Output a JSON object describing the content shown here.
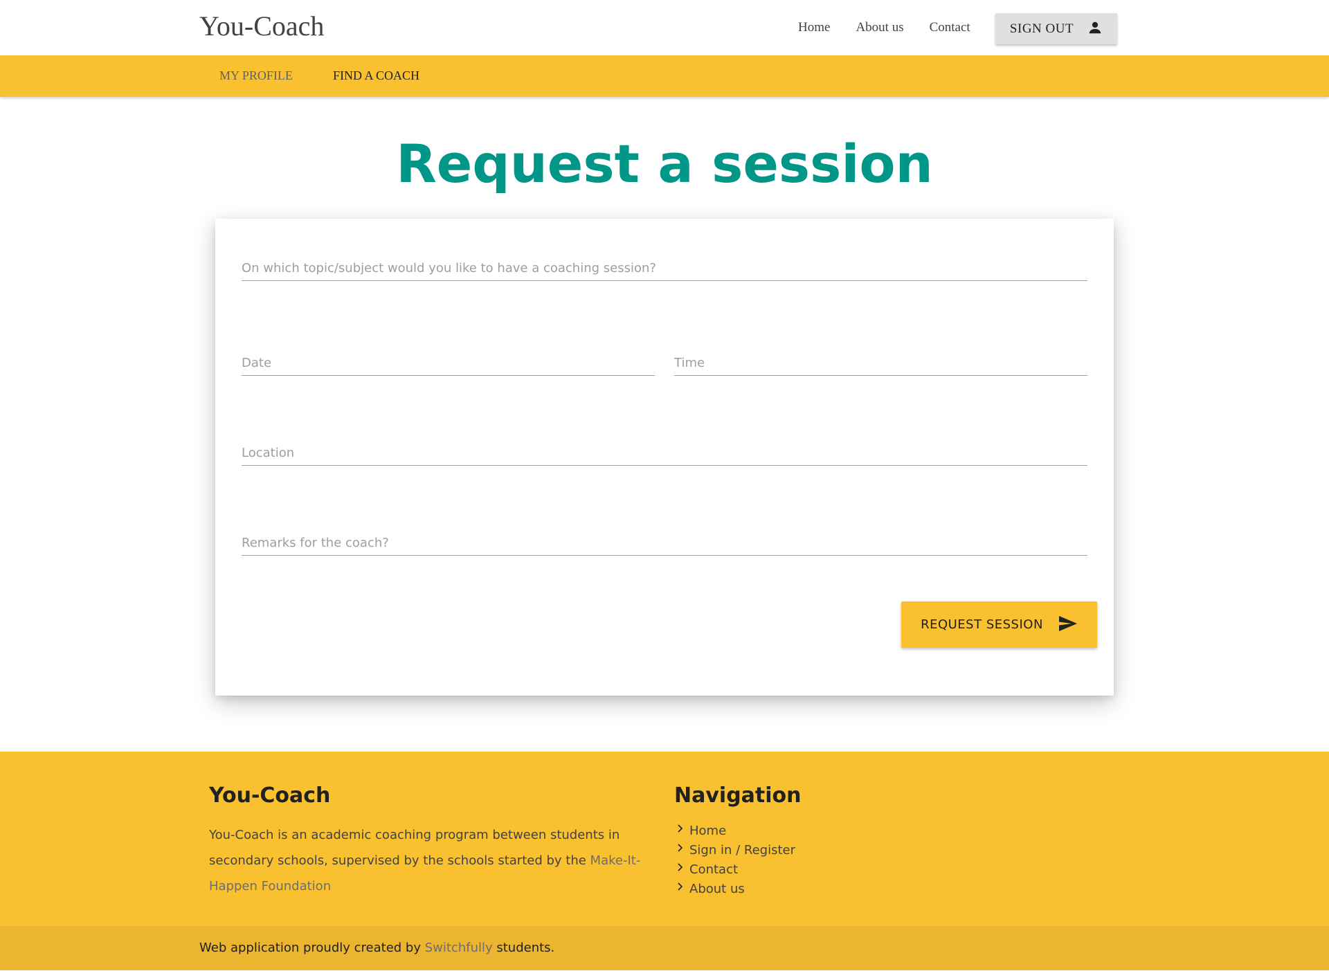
{
  "header": {
    "brand": "You-Coach",
    "nav": [
      "Home",
      "About us",
      "Contact"
    ],
    "signout_label": "SIGN OUT",
    "signout_icon": "person-icon"
  },
  "subnav": {
    "items": [
      "MY PROFILE",
      "FIND A COACH"
    ],
    "active": "FIND A COACH",
    "accent_color": "#f9c02f"
  },
  "page": {
    "title": "Request a session",
    "title_color": "#009688"
  },
  "form": {
    "topic_placeholder": "On which topic/subject would you like to have a coaching session?",
    "date_placeholder": "Date",
    "time_placeholder": "Time",
    "location_placeholder": "Location",
    "remarks_placeholder": "Remarks for the coach?",
    "submit_label": "REQUEST SESSION",
    "submit_icon": "send-icon"
  },
  "footer": {
    "brand_title": "You-Coach",
    "description_text": "You-Coach is an academic coaching program between students in secondary schools, supervised by the schools started by the ",
    "description_link": "Make-It-Happen Foundation",
    "nav_title": "Navigation",
    "nav_links": [
      "Home",
      "Sign in / Register",
      "Contact",
      "About us"
    ],
    "link_icon": "chevron-right-icon"
  },
  "copyright": {
    "prefix": "Web application proudly created by ",
    "link": "Switchfully",
    "suffix": " students."
  }
}
